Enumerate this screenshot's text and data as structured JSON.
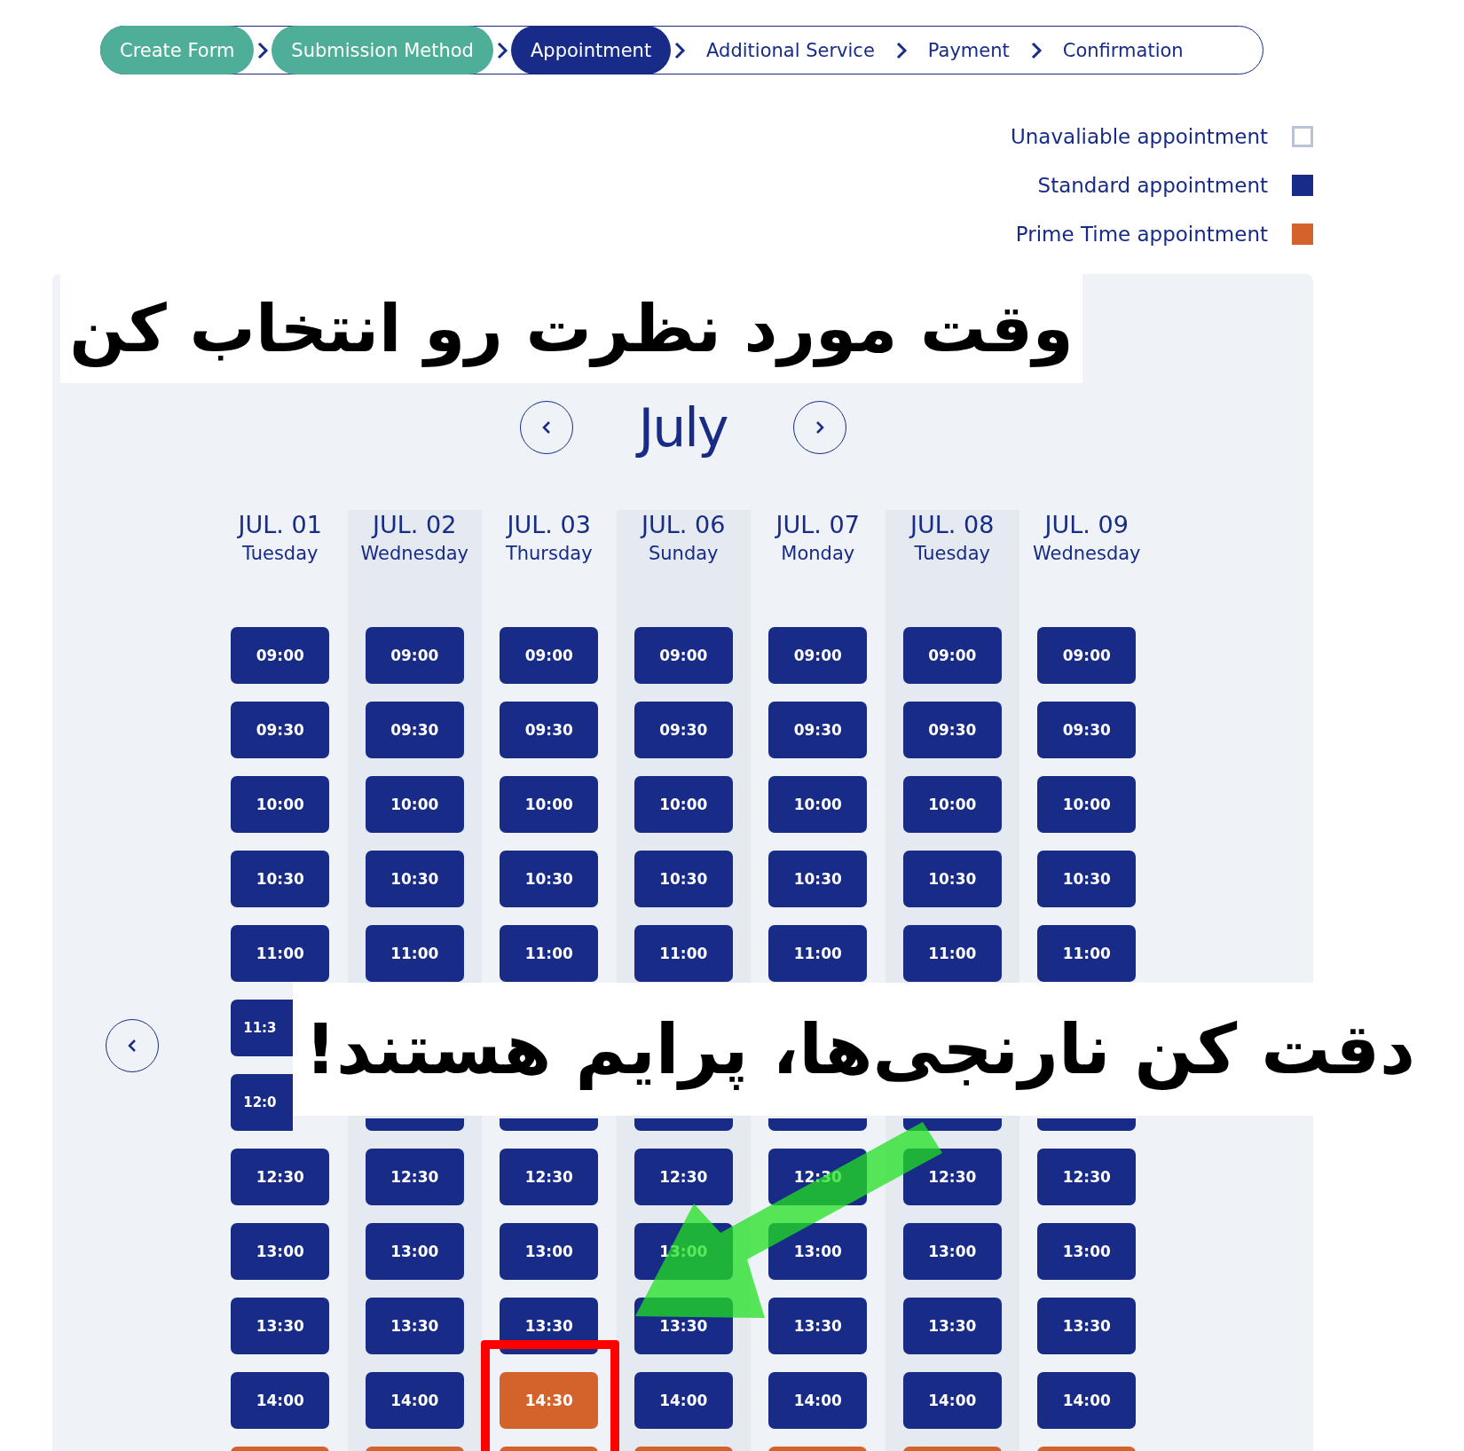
{
  "steps": [
    {
      "label": "Create Form",
      "done": true,
      "selected": false
    },
    {
      "label": "Submission Method",
      "done": true,
      "selected": false
    },
    {
      "label": "Appointment",
      "done": false,
      "selected": true
    },
    {
      "label": "Additional Service",
      "done": false,
      "selected": false
    },
    {
      "label": "Payment",
      "done": false,
      "selected": false
    },
    {
      "label": "Confirmation",
      "done": false,
      "selected": false
    }
  ],
  "legend": [
    {
      "label": "Unavaliable appointment",
      "kind": "unavailable"
    },
    {
      "label": "Standard appointment",
      "kind": "standard"
    },
    {
      "label": "Prime Time appointment",
      "kind": "prime"
    }
  ],
  "month": "July",
  "days": [
    {
      "date": "JUL. 01",
      "weekday": "Tuesday",
      "slots": [
        {
          "time": "09:00",
          "kind": "standard"
        },
        {
          "time": "09:30",
          "kind": "standard"
        },
        {
          "time": "10:00",
          "kind": "standard"
        },
        {
          "time": "10:30",
          "kind": "standard"
        },
        {
          "time": "11:00",
          "kind": "standard"
        },
        {
          "time": "11:3",
          "kind": "standard",
          "partial": true
        },
        {
          "time": "12:0",
          "kind": "standard",
          "partial": true
        },
        {
          "time": "12:30",
          "kind": "standard"
        },
        {
          "time": "13:00",
          "kind": "standard"
        },
        {
          "time": "13:30",
          "kind": "standard"
        },
        {
          "time": "14:00",
          "kind": "standard"
        },
        {
          "kind": "prime"
        }
      ]
    },
    {
      "date": "JUL. 02",
      "weekday": "Wednesday",
      "slots": [
        {
          "time": "09:00",
          "kind": "standard"
        },
        {
          "time": "09:30",
          "kind": "standard"
        },
        {
          "time": "10:00",
          "kind": "standard"
        },
        {
          "time": "10:30",
          "kind": "standard"
        },
        {
          "time": "11:00",
          "kind": "standard"
        },
        {
          "kind": "standard",
          "partial": true
        },
        {
          "time": "12:30",
          "kind": "standard"
        },
        {
          "time": "13:00",
          "kind": "standard"
        },
        {
          "time": "13:30",
          "kind": "standard"
        },
        {
          "time": "14:00",
          "kind": "standard"
        },
        {
          "kind": "prime"
        }
      ]
    },
    {
      "date": "JUL. 03",
      "weekday": "Thursday",
      "slots": [
        {
          "time": "09:00",
          "kind": "standard"
        },
        {
          "time": "09:30",
          "kind": "standard"
        },
        {
          "time": "10:00",
          "kind": "standard"
        },
        {
          "time": "10:30",
          "kind": "standard"
        },
        {
          "time": "11:00",
          "kind": "standard"
        },
        {
          "kind": "standard",
          "partial": true
        },
        {
          "time": "12:30",
          "kind": "standard"
        },
        {
          "time": "13:00",
          "kind": "standard"
        },
        {
          "time": "13:30",
          "kind": "standard"
        },
        {
          "time": "14:30",
          "kind": "prime"
        },
        {
          "kind": "prime"
        }
      ]
    },
    {
      "date": "JUL. 06",
      "weekday": "Sunday",
      "slots": [
        {
          "time": "09:00",
          "kind": "standard"
        },
        {
          "time": "09:30",
          "kind": "standard"
        },
        {
          "time": "10:00",
          "kind": "standard"
        },
        {
          "time": "10:30",
          "kind": "standard"
        },
        {
          "time": "11:00",
          "kind": "standard"
        },
        {
          "kind": "standard",
          "partial": true
        },
        {
          "time": "12:30",
          "kind": "standard"
        },
        {
          "time": "13:00",
          "kind": "standard"
        },
        {
          "time": "13:30",
          "kind": "standard"
        },
        {
          "time": "14:00",
          "kind": "standard"
        },
        {
          "kind": "prime"
        }
      ]
    },
    {
      "date": "JUL. 07",
      "weekday": "Monday",
      "slots": [
        {
          "time": "09:00",
          "kind": "standard"
        },
        {
          "time": "09:30",
          "kind": "standard"
        },
        {
          "time": "10:00",
          "kind": "standard"
        },
        {
          "time": "10:30",
          "kind": "standard"
        },
        {
          "time": "11:00",
          "kind": "standard"
        },
        {
          "kind": "standard",
          "partial": true
        },
        {
          "time": "12:30",
          "kind": "standard"
        },
        {
          "time": "13:00",
          "kind": "standard"
        },
        {
          "time": "13:30",
          "kind": "standard"
        },
        {
          "time": "14:00",
          "kind": "standard"
        },
        {
          "kind": "prime"
        }
      ]
    },
    {
      "date": "JUL. 08",
      "weekday": "Tuesday",
      "slots": [
        {
          "time": "09:00",
          "kind": "standard"
        },
        {
          "time": "09:30",
          "kind": "standard"
        },
        {
          "time": "10:00",
          "kind": "standard"
        },
        {
          "time": "10:30",
          "kind": "standard"
        },
        {
          "time": "11:00",
          "kind": "standard"
        },
        {
          "kind": "standard",
          "partial": true
        },
        {
          "time": "12:30",
          "kind": "standard"
        },
        {
          "time": "13:00",
          "kind": "standard"
        },
        {
          "time": "13:30",
          "kind": "standard"
        },
        {
          "time": "14:00",
          "kind": "standard"
        },
        {
          "kind": "prime"
        }
      ]
    },
    {
      "date": "JUL. 09",
      "weekday": "Wednesday",
      "slots": [
        {
          "time": "09:00",
          "kind": "standard"
        },
        {
          "time": "09:30",
          "kind": "standard"
        },
        {
          "time": "10:00",
          "kind": "standard"
        },
        {
          "time": "10:30",
          "kind": "standard"
        },
        {
          "time": "11:00",
          "kind": "standard"
        },
        {
          "kind": "standard",
          "partial": true
        },
        {
          "time": "12:30",
          "kind": "standard"
        },
        {
          "time": "13:00",
          "kind": "standard"
        },
        {
          "time": "13:30",
          "kind": "standard"
        },
        {
          "time": "14:00",
          "kind": "standard"
        },
        {
          "kind": "prime"
        }
      ]
    }
  ],
  "annotations": [
    {
      "text": "وقت مورد نظرت رو انتخاب کن",
      "kind": "top"
    },
    {
      "text": "دقت کن نارنجی‌ها، پرایم هستند!",
      "kind": "middle"
    }
  ]
}
